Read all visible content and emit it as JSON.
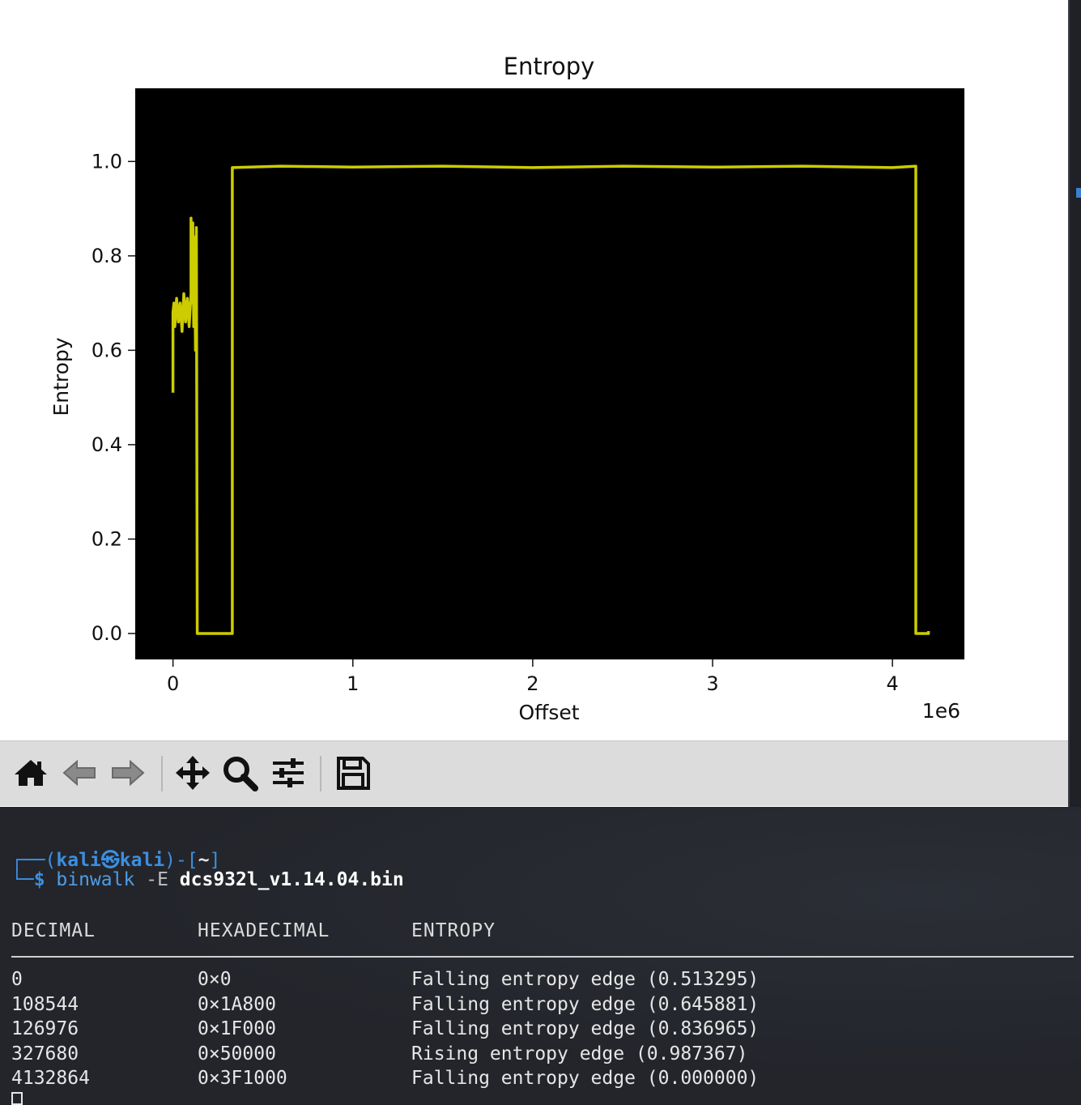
{
  "chart_data": {
    "type": "line",
    "title": "Entropy",
    "xlabel": "Offset",
    "ylabel": "Entropy",
    "x_offset_text": "1e6",
    "xlim": [
      -0.21,
      4.4
    ],
    "ylim": [
      -0.055,
      1.155
    ],
    "x_ticks": [
      0,
      1,
      2,
      3,
      4
    ],
    "x_tick_labels": [
      "0",
      "1",
      "2",
      "3",
      "4"
    ],
    "y_ticks": [
      0.0,
      0.2,
      0.4,
      0.6,
      0.8,
      1.0
    ],
    "y_tick_labels": [
      "0.0",
      "0.2",
      "0.4",
      "0.6",
      "0.8",
      "1.0"
    ],
    "grid": false,
    "background": "#000000",
    "line_color": "#cccc00",
    "series": [
      {
        "x": [
          0.0,
          0.0,
          0.005,
          0.01,
          0.02,
          0.03,
          0.04,
          0.05,
          0.06,
          0.07,
          0.08,
          0.09,
          0.1,
          0.1,
          0.105,
          0.11,
          0.115,
          0.12,
          0.125,
          0.13,
          0.135,
          0.135,
          0.33,
          0.33,
          0.6,
          1.0,
          1.5,
          2.0,
          2.5,
          3.0,
          3.5,
          4.0,
          4.13,
          4.13,
          4.2,
          4.2
        ],
        "y": [
          0.51,
          0.68,
          0.7,
          0.65,
          0.71,
          0.66,
          0.7,
          0.64,
          0.72,
          0.66,
          0.71,
          0.65,
          0.72,
          0.88,
          0.7,
          0.87,
          0.65,
          0.84,
          0.6,
          0.86,
          0.0,
          0.0,
          0.0,
          0.987,
          0.99,
          0.988,
          0.99,
          0.987,
          0.99,
          0.988,
          0.99,
          0.987,
          0.99,
          0.0,
          0.0,
          0.005
        ]
      }
    ]
  },
  "toolbar": {
    "buttons": [
      {
        "name": "home-icon",
        "label": "Home"
      },
      {
        "name": "back-icon",
        "label": "Back"
      },
      {
        "name": "forward-icon",
        "label": "Forward"
      },
      {
        "name": "pan-icon",
        "label": "Pan"
      },
      {
        "name": "zoom-icon",
        "label": "Zoom"
      },
      {
        "name": "configure-subplots-icon",
        "label": "Configure subplots"
      },
      {
        "name": "save-icon",
        "label": "Save"
      }
    ]
  },
  "terminal": {
    "prompt_open": "┌──(",
    "user": "kali㉿kali",
    "prompt_close": ")-[",
    "cwd": "~",
    "prompt_end": "]",
    "prompt_corner": "└─",
    "dollar": "$",
    "command": "binwalk",
    "flag": "-E",
    "argument": "dcs932l_v1.14.04.bin",
    "headers": {
      "decimal": "DECIMAL",
      "hexadecimal": "HEXADECIMAL",
      "entropy": "ENTROPY"
    },
    "rows": [
      {
        "decimal": "0",
        "hex": "0×0",
        "entropy": "Falling entropy edge (0.513295)"
      },
      {
        "decimal": "108544",
        "hex": "0×1A800",
        "entropy": "Falling entropy edge (0.645881)"
      },
      {
        "decimal": "126976",
        "hex": "0×1F000",
        "entropy": "Falling entropy edge (0.836965)"
      },
      {
        "decimal": "327680",
        "hex": "0×50000",
        "entropy": "Rising entropy edge (0.987367)"
      },
      {
        "decimal": "4132864",
        "hex": "0×3F1000",
        "entropy": "Falling entropy edge (0.000000)"
      }
    ]
  }
}
